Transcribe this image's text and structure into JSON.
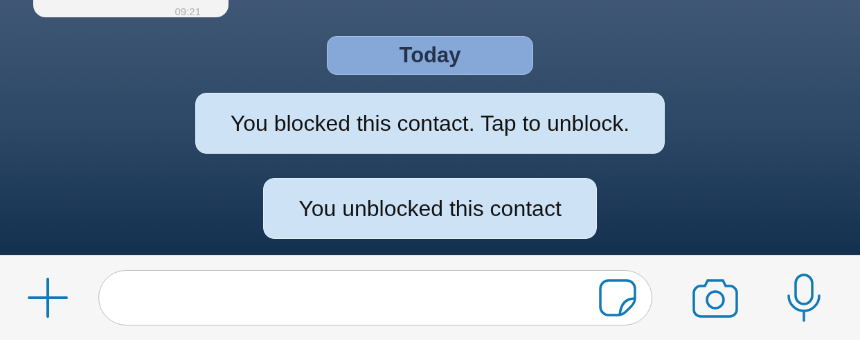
{
  "previous_message": {
    "time": "09:21"
  },
  "date_separator": "Today",
  "system_messages": [
    {
      "text": "You blocked this contact. Tap to unblock."
    },
    {
      "text": "You unblocked this contact"
    }
  ]
}
